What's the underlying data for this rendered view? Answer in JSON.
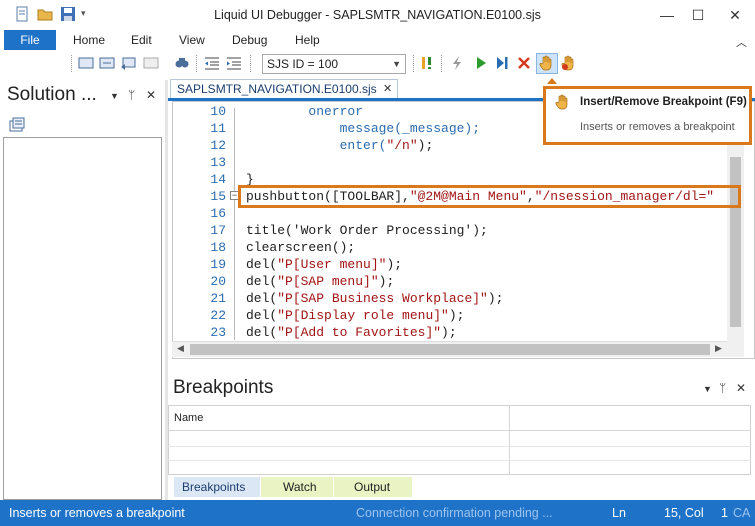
{
  "window": {
    "title": "Liquid UI Debugger - SAPLSMTR_NAVIGATION.E0100.sjs",
    "minimize": "—",
    "maximize": "☐",
    "close": "✕"
  },
  "menu": {
    "file": "File",
    "items": [
      "Home",
      "Edit",
      "View",
      "Debug",
      "Help"
    ]
  },
  "toolbar": {
    "sjs_select_value": "SJS ID = 100"
  },
  "solution_panel": {
    "title": "Solution ...",
    "pin": "ᛘ",
    "dropdown": "▼",
    "close": "✕"
  },
  "editor": {
    "tab_label": "SAPLSMTR_NAVIGATION.E0100.sjs",
    "tab_close": "✕",
    "lines": [
      {
        "num": "10",
        "code": "        onerror"
      },
      {
        "num": "11",
        "code": "            message(_message);"
      },
      {
        "num": "12",
        "code": "            enter(\"/n\");"
      },
      {
        "num": "13",
        "code": ""
      },
      {
        "num": "14",
        "code": "}"
      },
      {
        "num": "15",
        "code": "pushbutton([TOOLBAR],\"@2M@Main Menu\",\"/nsession_manager/dl=\""
      },
      {
        "num": "16",
        "code": ""
      },
      {
        "num": "17",
        "code": "title('Work Order Processing');"
      },
      {
        "num": "18",
        "code": "clearscreen();"
      },
      {
        "num": "19",
        "code": "del(\"P[User menu]\");"
      },
      {
        "num": "20",
        "code": "del(\"P[SAP menu]\");"
      },
      {
        "num": "21",
        "code": "del(\"P[SAP Business Workplace]\");"
      },
      {
        "num": "22",
        "code": "del(\"P[Display role menu]\");"
      },
      {
        "num": "23",
        "code": "del(\"P[Add to Favorites]\");"
      }
    ]
  },
  "tooltip": {
    "title": "Insert/Remove Breakpoint (F9)",
    "description": "Inserts or removes a breakpoint"
  },
  "breakpoints_panel": {
    "title": "Breakpoints",
    "column_name": "Name",
    "pin": "ᛘ",
    "dropdown": "▼",
    "close": "✕"
  },
  "bottom_tabs": [
    "Breakpoints",
    "Watch",
    "Output"
  ],
  "status": {
    "message": "Inserts or removes a breakpoint",
    "connection": "Connection confirmation pending ...",
    "ln": "Ln",
    "position": "15, Col     1",
    "mode": "CA"
  },
  "colors": {
    "accent": "#1e73c8",
    "highlight": "#d9791c"
  }
}
